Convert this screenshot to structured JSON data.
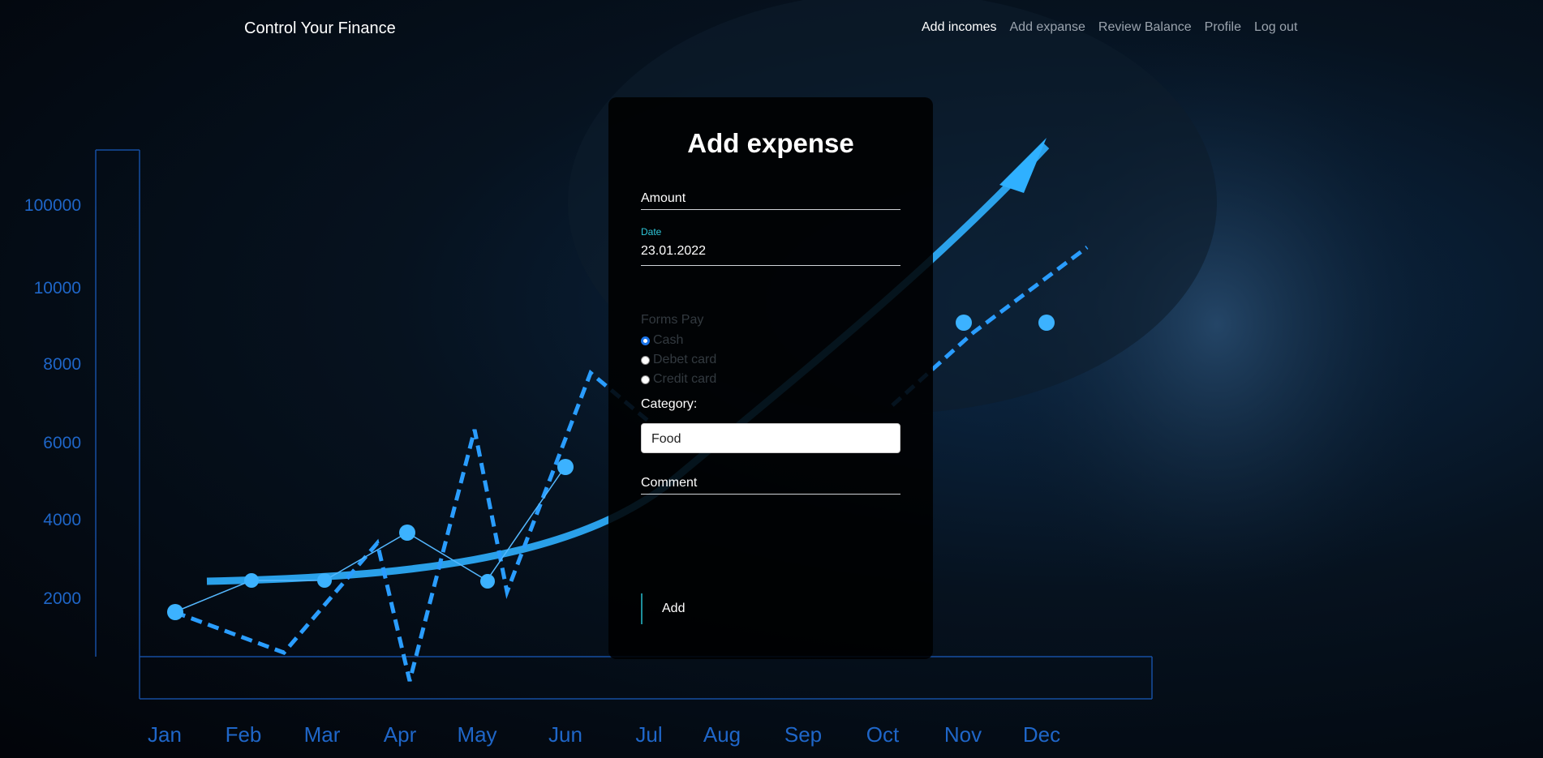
{
  "brand": "Control Your Finance",
  "nav": [
    "Add incomes",
    "Add expanse",
    "Review Balance",
    "Profile",
    "Log out"
  ],
  "form": {
    "title": "Add expense",
    "amount_label": "Amount",
    "date_label": "Date",
    "date_value": "23.01.2022",
    "pay_title": "Forms Pay",
    "pay_options": [
      "Cash",
      "Debet card",
      "Credit card"
    ],
    "pay_selected": "Cash",
    "category_label": "Category:",
    "category_value": "Food",
    "comment_label": "Comment",
    "add_label": "Add"
  },
  "background": {
    "y_ticks": [
      "100000",
      "10000",
      "8000",
      "6000",
      "4000",
      "2000"
    ],
    "months": [
      "Jan",
      "Feb",
      "Mar",
      "Apr",
      "May",
      "Jun",
      "Jul",
      "Aug",
      "Sep",
      "Oct",
      "Nov",
      "Dec"
    ]
  },
  "colors": {
    "accent": "#2ec6d8",
    "glow": "#2a9dff"
  }
}
